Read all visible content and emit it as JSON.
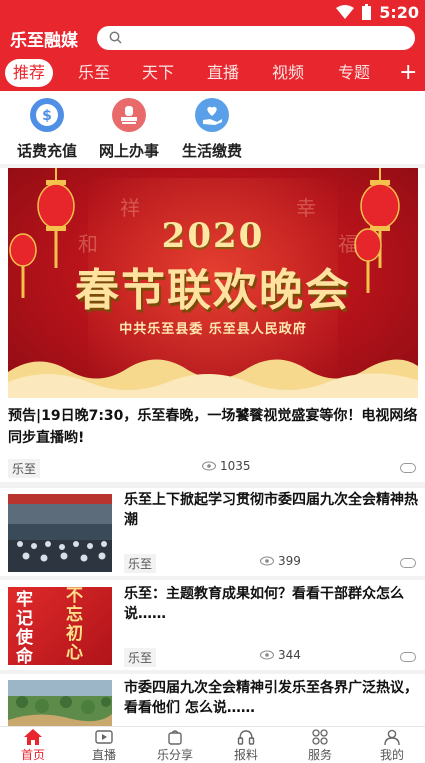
{
  "status": {
    "time": "5:20"
  },
  "app": {
    "title": "乐至融媒"
  },
  "search": {
    "placeholder": ""
  },
  "tabs": [
    {
      "label": "推荐",
      "active": true
    },
    {
      "label": "乐至",
      "active": false
    },
    {
      "label": "天下",
      "active": false
    },
    {
      "label": "直播",
      "active": false
    },
    {
      "label": "视频",
      "active": false
    },
    {
      "label": "专题",
      "active": false
    }
  ],
  "services": [
    {
      "label": "话费充值",
      "icon": "dollar-icon",
      "color": "#4f8fe6"
    },
    {
      "label": "网上办事",
      "icon": "stamp-icon",
      "color": "#e86a6a"
    },
    {
      "label": "生活缴费",
      "icon": "hand-heart-icon",
      "color": "#5aa0e8"
    }
  ],
  "banner": {
    "year": "2020",
    "title": "春节联欢晚会",
    "subtitle": "中共乐至县委  乐至县人民政府",
    "decor": [
      "祥",
      "幸",
      "和",
      "福"
    ]
  },
  "lead": {
    "title": "预告|19日晚7:30，乐至春晚，一场饕餮视觉盛宴等你！电视网络同步直播哟!",
    "tag": "乐至",
    "views": "1035"
  },
  "news": [
    {
      "title": "乐至上下掀起学习贯彻市委四届九次全会精神热潮",
      "tag": "乐至",
      "views": "399"
    },
    {
      "title": "乐至：主题教育成果如何？看看干部群众怎么说……",
      "tag": "乐至",
      "views": "344",
      "thumb_text": [
        "牢记",
        "使命",
        "不忘",
        "初心"
      ]
    },
    {
      "title": "市委四届九次全会精神引发乐至各界广泛热议，看看他们 怎么说……",
      "tag": "",
      "views": ""
    }
  ],
  "bottom_nav": [
    {
      "label": "首页",
      "icon": "home-icon",
      "active": true
    },
    {
      "label": "直播",
      "icon": "tv-icon",
      "active": false
    },
    {
      "label": "乐分享",
      "icon": "share-bag-icon",
      "active": false
    },
    {
      "label": "报料",
      "icon": "headset-icon",
      "active": false
    },
    {
      "label": "服务",
      "icon": "grid-icon",
      "active": false
    },
    {
      "label": "我的",
      "icon": "user-icon",
      "active": false
    }
  ],
  "colors": {
    "brand": "#e8262d",
    "gold": "#ffe2a0"
  }
}
